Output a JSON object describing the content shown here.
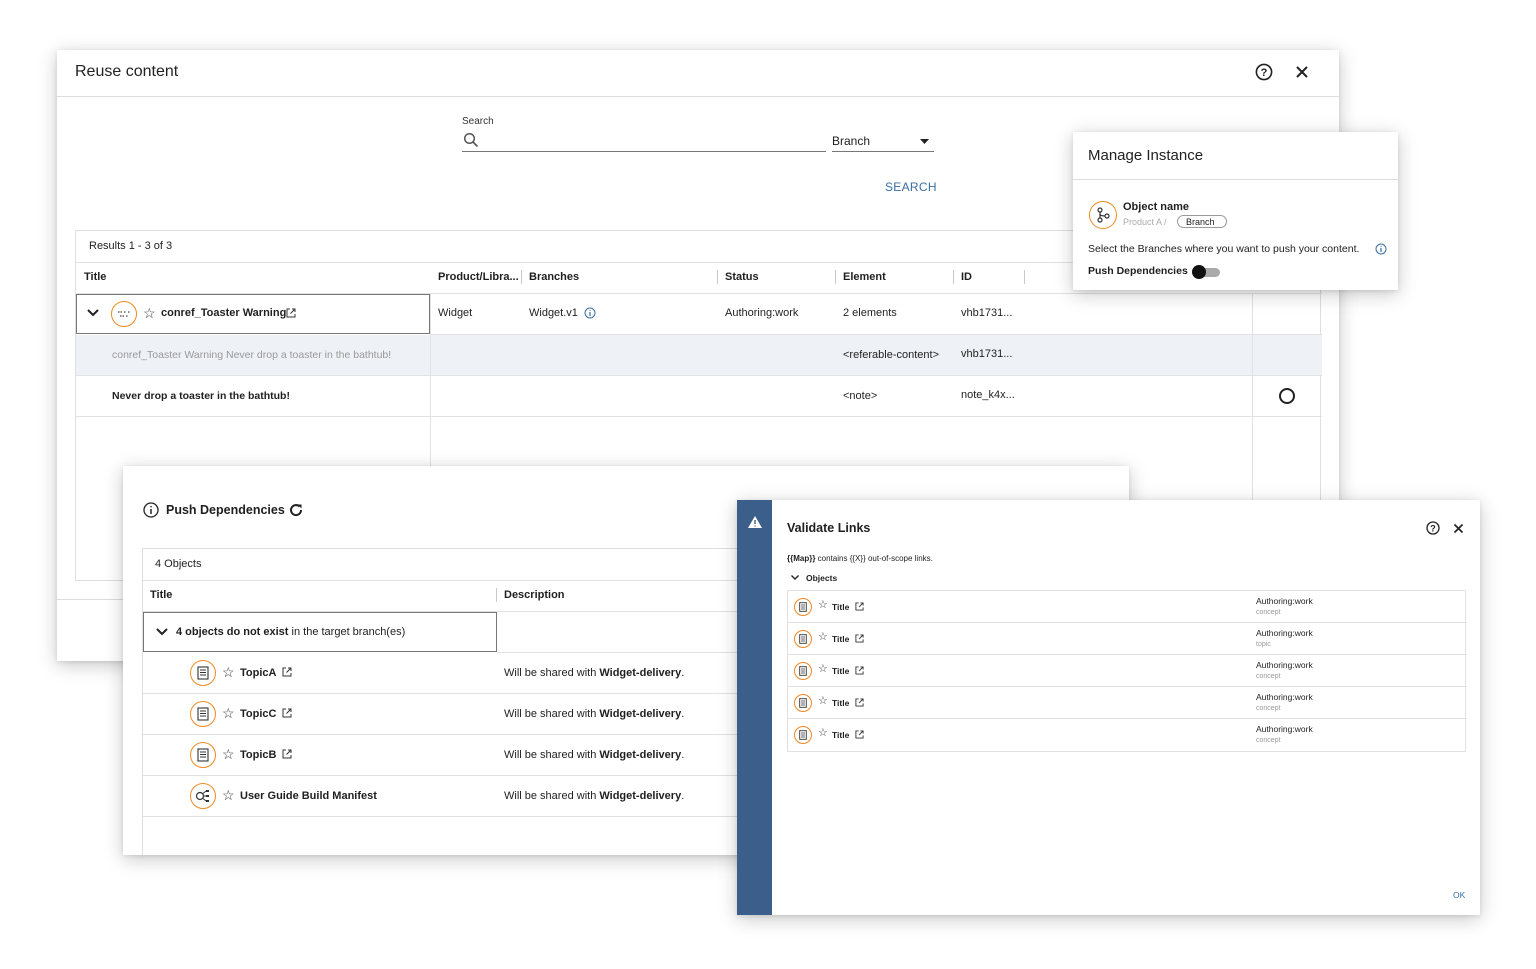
{
  "reuse": {
    "title": "Reuse content",
    "search_label": "Search",
    "search_value": "",
    "branch_select": "Branch",
    "search_button": "SEARCH",
    "results": "Results 1 - 3 of 3",
    "columns": [
      "Title",
      "Product/Libra...",
      "Branches",
      "Status",
      "Element",
      "ID"
    ],
    "rows": [
      {
        "title": "conref_Toaster Warning",
        "product": "Widget",
        "branch": "Widget.v1",
        "status": "Authoring:work",
        "element": "2 elements",
        "id": "vhb1731..."
      },
      {
        "title": "conref_Toaster Warning Never drop a toaster in the bathtub!",
        "element": "<referable-content>",
        "id": "vhb1731..."
      },
      {
        "title": "Never drop a toaster in the bathtub!",
        "element": "<note>",
        "id": "note_k4x..."
      }
    ]
  },
  "manage": {
    "title": "Manage Instance",
    "object_name": "Object name",
    "path_prefix": "Product A /",
    "branch_chip": "Branch",
    "instruction": "Select the Branches where you want to push your content.",
    "push_label": "Push Dependencies",
    "push_enabled": false
  },
  "push": {
    "title": "Push Dependencies",
    "count": "4 Objects",
    "col_title": "Title",
    "col_desc": "Description",
    "group_bold": "4 objects do not exist",
    "group_rest": " in the target branch(es)",
    "desc_prefix": "Will be shared with ",
    "desc_target": "Widget-delivery",
    "desc_suffix": ".",
    "items": [
      {
        "name": "TopicA",
        "icon": "topic-icon"
      },
      {
        "name": "TopicC",
        "icon": "topic-icon"
      },
      {
        "name": "TopicB",
        "icon": "topic-icon"
      },
      {
        "name": "User Guide Build Manifest",
        "icon": "map-icon"
      }
    ]
  },
  "validate": {
    "title": "Validate Links",
    "msg_bold": "{{Map}}",
    "msg_rest": " contains {{X}} out-of-scope links.",
    "objects_label": "Objects",
    "items": [
      {
        "title": "Title",
        "status": "Authoring:work",
        "type": "concept"
      },
      {
        "title": "Title",
        "status": "Authoring:work",
        "type": "topic"
      },
      {
        "title": "Title",
        "status": "Authoring:work",
        "type": "concept"
      },
      {
        "title": "Title",
        "status": "Authoring:work",
        "type": "concept"
      },
      {
        "title": "Title",
        "status": "Authoring:work",
        "type": "concept"
      }
    ],
    "ok": "OK"
  },
  "colors": {
    "accent": "#f08a24",
    "sidebar": "#3b5f8a",
    "link": "#3a6ea5"
  }
}
